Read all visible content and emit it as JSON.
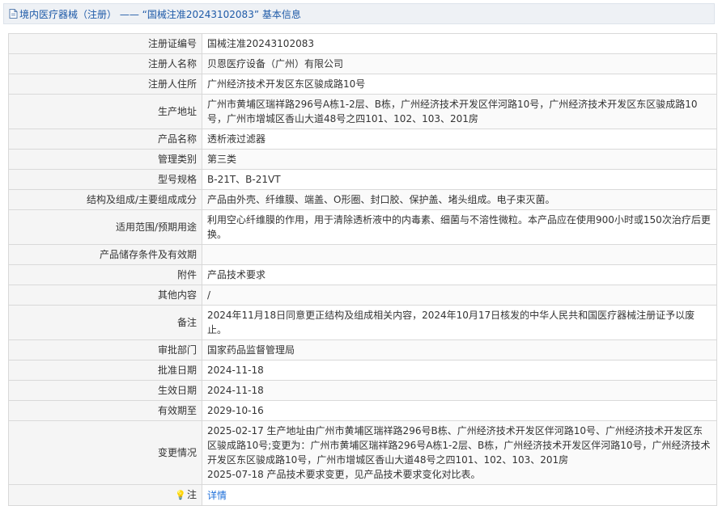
{
  "header": {
    "breadcrumb": "境内医疗器械（注册） —— “国械注准20243102083” 基本信息"
  },
  "rows": [
    {
      "label": "注册证编号",
      "value": "国械注准20243102083"
    },
    {
      "label": "注册人名称",
      "value": "贝恩医疗设备（广州）有限公司"
    },
    {
      "label": "注册人住所",
      "value": "广州经济技术开发区东区骏成路10号"
    },
    {
      "label": "生产地址",
      "value": "广州市黄埔区瑞祥路296号A栋1-2层、B栋，广州经济技术开发区伴河路10号，广州经济技术开发区东区骏成路10号，广州市增城区香山大道48号之四101、102、103、201房"
    },
    {
      "label": "产品名称",
      "value": "透析液过滤器"
    },
    {
      "label": "管理类别",
      "value": "第三类"
    },
    {
      "label": "型号规格",
      "value": "B-21T、B-21VT"
    },
    {
      "label": "结构及组成/主要组成成分",
      "value": "产品由外壳、纤维膜、端盖、O形圈、封口胶、保护盖、堵头组成。电子束灭菌。"
    },
    {
      "label": "适用范围/预期用途",
      "value": "利用空心纤维膜的作用，用于清除透析液中的内毒素、细菌与不溶性微粒。本产品应在使用900小时或150次治疗后更换。"
    },
    {
      "label": "产品储存条件及有效期",
      "value": ""
    },
    {
      "label": "附件",
      "value": "产品技术要求"
    },
    {
      "label": "其他内容",
      "value": "/"
    },
    {
      "label": "备注",
      "value": "2024年11月18日同意更正结构及组成相关内容，2024年10月17日核发的中华人民共和国医疗器械注册证予以废止。"
    },
    {
      "label": "审批部门",
      "value": "国家药品监督管理局"
    },
    {
      "label": "批准日期",
      "value": "2024-11-18"
    },
    {
      "label": "生效日期",
      "value": "2024-11-18"
    },
    {
      "label": "有效期至",
      "value": "2029-10-16"
    }
  ],
  "changes": {
    "label": "变更情况",
    "line1": "2025-02-17 生产地址由广州市黄埔区瑞祥路296号B栋、广州经济技术开发区伴河路10号、广州经济技术开发区东区骏成路10号;变更为：广州市黄埔区瑞祥路296号A栋1-2层、B栋，广州经济技术开发区伴河路10号，广州经济技术开发区东区骏成路10号，广州市增城区香山大道48号之四101、102、103、201房",
    "line2": "2025-07-18 产品技术要求变更，见产品技术要求变化对比表。"
  },
  "note": {
    "label": "注",
    "link": "详情",
    "icon": "lightbulb-icon"
  }
}
